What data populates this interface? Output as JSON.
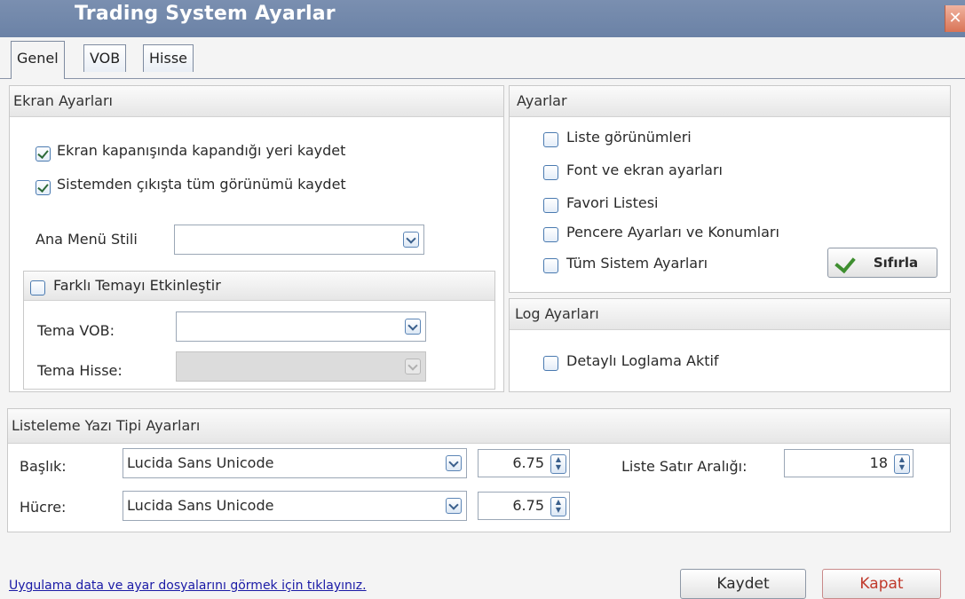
{
  "window": {
    "title": "Trading System Ayarlar",
    "close_label": "✕"
  },
  "tabs": [
    {
      "label": "Genel"
    },
    {
      "label": "VOB"
    },
    {
      "label": "Hisse"
    }
  ],
  "ekran": {
    "title": "Ekran Ayarları",
    "cb1": "Ekran kapanışında kapandığı yeri kaydet",
    "cb2": "Sistemden çıkışta tüm görünümü kaydet",
    "ana_menu_label": "Ana Menü Stili",
    "ana_menu_value": "",
    "farkli_tema": "Farklı Temayı Etkinleştir",
    "tema_vob_label": "Tema VOB:",
    "tema_vob_value": "",
    "tema_hisse_label": "Tema Hisse:",
    "tema_hisse_value": ""
  },
  "ayarlar": {
    "title": "Ayarlar",
    "items": [
      "Liste görünümleri",
      "Font ve ekran ayarları",
      "Favori Listesi",
      "Pencere Ayarları ve Konumları",
      "Tüm Sistem Ayarları"
    ],
    "reset_label": "Sıfırla"
  },
  "log": {
    "title": "Log Ayarları",
    "detayli": "Detaylı Loglama Aktif"
  },
  "listeleme": {
    "title": "Listeleme Yazı Tipi Ayarları",
    "baslik_label": "Başlık:",
    "baslik_font": "Lucida Sans Unicode",
    "baslik_size": "6.75",
    "hucre_label": "Hücre:",
    "hucre_font": "Lucida Sans Unicode",
    "hucre_size": "6.75",
    "satir_label": "Liste Satır Aralığı:",
    "satir_value": "18"
  },
  "footer": {
    "link": "Uygulama data ve ayar dosyalarını görmek için tıklayınız.",
    "save": "Kaydet",
    "close": "Kapat"
  }
}
